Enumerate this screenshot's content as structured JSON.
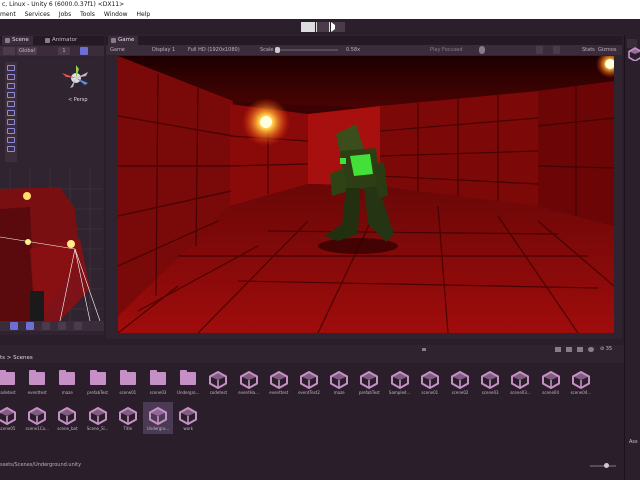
{
  "window": {
    "title": "c, Linux - Unity 6 (6000.0.37f1) <DX11>"
  },
  "menu": [
    "ment",
    "Services",
    "Jobs",
    "Tools",
    "Window",
    "Help"
  ],
  "tabs": {
    "scene": "Scene",
    "animator": "Animator",
    "game": "Game"
  },
  "scene_toolbar": {
    "mode": "Global",
    "count": "1"
  },
  "scene_gizmo": {
    "persp_label": "< Persp"
  },
  "game_toolbar": {
    "view": "Game",
    "display": "Display 1",
    "resolution": "Full HD (1920x1080)",
    "scale_label": "Scale",
    "scale_value": "0.58x",
    "play_mode": "Play Focused",
    "stats": "Stats",
    "gizmos": "Gizmos"
  },
  "project": {
    "path": "ts > Scenes",
    "count_badge": "35",
    "items": [
      {
        "name": "codetest",
        "kind": "folder"
      },
      {
        "name": "eventtest",
        "kind": "folder"
      },
      {
        "name": "maze",
        "kind": "folder"
      },
      {
        "name": "prefabTest",
        "kind": "folder"
      },
      {
        "name": "scene01",
        "kind": "folder"
      },
      {
        "name": "scene03",
        "kind": "folder"
      },
      {
        "name": "Undergro...",
        "kind": "folder"
      },
      {
        "name": "codetest",
        "kind": "unity"
      },
      {
        "name": "eventHa...",
        "kind": "unity"
      },
      {
        "name": "eventtest",
        "kind": "unity"
      },
      {
        "name": "eventTest2",
        "kind": "unity"
      },
      {
        "name": "maze",
        "kind": "unity"
      },
      {
        "name": "prefabTest",
        "kind": "unity"
      },
      {
        "name": "Sampled...",
        "kind": "unity"
      },
      {
        "name": "scene01",
        "kind": "unity"
      },
      {
        "name": "scene02",
        "kind": "unity"
      },
      {
        "name": "scene03",
        "kind": "unity"
      },
      {
        "name": "scene03...",
        "kind": "unity"
      },
      {
        "name": "scene04",
        "kind": "unity"
      },
      {
        "name": "scene04...",
        "kind": "unity"
      },
      {
        "name": "scene05",
        "kind": "unity"
      },
      {
        "name": "scene1Co...",
        "kind": "unity"
      },
      {
        "name": "scene_bat",
        "kind": "unity"
      },
      {
        "name": "Scene_Sl...",
        "kind": "unity"
      },
      {
        "name": "Title",
        "kind": "unity"
      },
      {
        "name": "Undergro...",
        "kind": "unity",
        "selected": true
      },
      {
        "name": "work",
        "kind": "unity"
      }
    ]
  },
  "status": {
    "path": "ssets/Scenes/Underground.unity"
  },
  "right_panel": {
    "label": "Ass"
  },
  "colors": {
    "accent": "#6c6fd8",
    "unity_icon": "#c690c6",
    "play": "#6c6fd8"
  }
}
